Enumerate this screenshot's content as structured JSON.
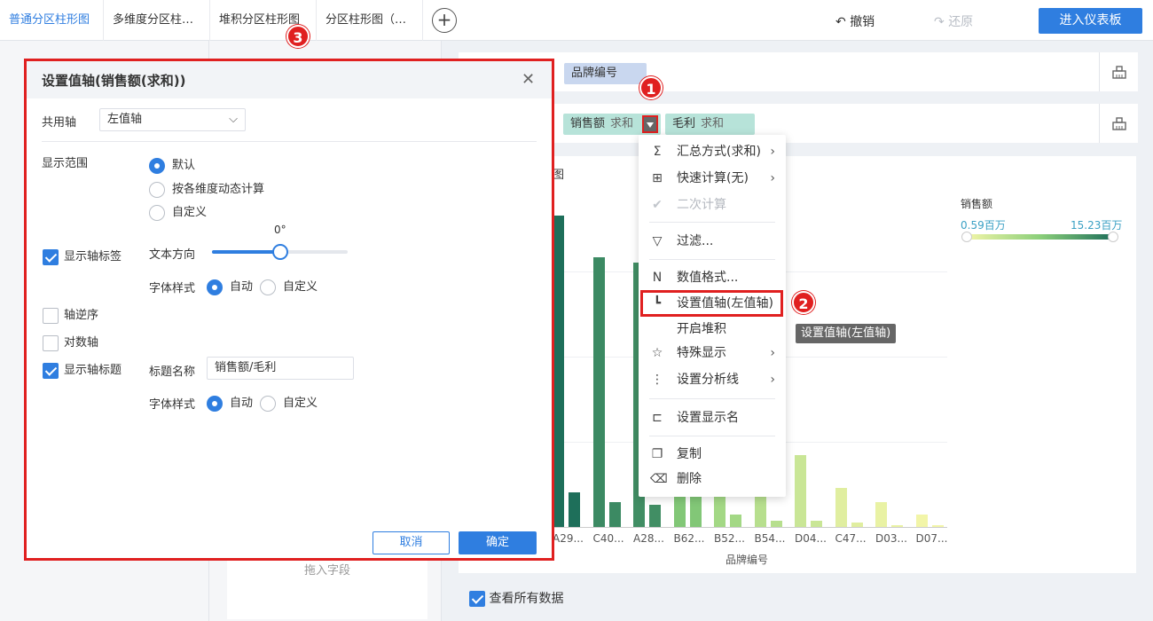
{
  "tabs": [
    {
      "label": "普通分区柱形图",
      "active": true
    },
    {
      "label": "多维度分区柱…"
    },
    {
      "label": "堆积分区柱形图"
    },
    {
      "label": "分区柱形图（…"
    }
  ],
  "toolbar": {
    "undo_label": "撤销",
    "redo_label": "还原",
    "enter_dashboard_label": "进入仪表板"
  },
  "fields": {
    "dimension_pill": "品牌编号",
    "sales_pill": {
      "name": "销售额",
      "agg": "求和"
    },
    "profit_pill": {
      "name": "毛利",
      "agg": "求和"
    }
  },
  "left_panel": {
    "drop_field_label": "拖入字段"
  },
  "chart": {
    "title_fragment": "图",
    "legend": {
      "title": "销售额",
      "min": "0.59百万",
      "max": "15.23百万"
    },
    "xlabel": "品牌编号"
  },
  "chart_data": {
    "type": "bar",
    "categories": [
      "A29...",
      "C40...",
      "A28...",
      "B62...",
      "B52...",
      "B54...",
      "D04...",
      "C47...",
      "D03...",
      "D07..."
    ],
    "series": [
      {
        "name": "销售额",
        "values": [
          15.23,
          13.2,
          12.9,
          8.5,
          6.2,
          4.8,
          3.5,
          1.9,
          1.2,
          0.59
        ]
      },
      {
        "name": "毛利",
        "values": [
          1.7,
          1.2,
          1.1,
          1.5,
          0.6,
          0.3,
          0.3,
          0.2,
          0.1,
          0.1
        ]
      }
    ],
    "xlabel": "品牌编号",
    "legend_position": "top-right"
  },
  "view_all": {
    "label": "查看所有数据",
    "checked": true
  },
  "menu": {
    "items": [
      {
        "label": "汇总方式(求和)",
        "icon": "sigma-icon",
        "glyph": "Σ",
        "submenu": true
      },
      {
        "label": "快速计算(无)",
        "icon": "quick-calc-icon",
        "glyph": "⊞",
        "submenu": true
      },
      {
        "label": "二次计算",
        "icon": "check-icon",
        "glyph": "✔",
        "disabled": true
      },
      {
        "label": "过滤...",
        "icon": "filter-icon",
        "glyph": "▽"
      },
      {
        "label": "数值格式...",
        "icon": "number-format-icon",
        "glyph": "N"
      },
      {
        "label": "设置值轴(左值轴)",
        "icon": "value-axis-icon",
        "glyph": "┗"
      },
      {
        "label": "开启堆积",
        "icon": "",
        "glyph": ""
      },
      {
        "label": "特殊显示",
        "icon": "star-icon",
        "glyph": "☆",
        "submenu": true
      },
      {
        "label": "设置分析线",
        "icon": "analysis-line-icon",
        "glyph": "⋮",
        "submenu": true
      },
      {
        "label": "设置显示名",
        "icon": "rename-icon",
        "glyph": "⊏"
      },
      {
        "label": "复制",
        "icon": "copy-icon",
        "glyph": "❐"
      },
      {
        "label": "删除",
        "icon": "trash-icon",
        "glyph": "🗑"
      }
    ],
    "tooltip": "设置值轴(左值轴)"
  },
  "steps": [
    "1",
    "2",
    "3"
  ],
  "dialog": {
    "title": "设置值轴(销售额(求和))",
    "shared_axis_label": "共用轴",
    "shared_axis_value": "左值轴",
    "range_label": "显示范围",
    "range_options": [
      "默认",
      "按各维度动态计算",
      "自定义"
    ],
    "range_selected": 0,
    "show_axis_labels": {
      "label": "显示轴标签",
      "checked": true
    },
    "text_direction_label": "文本方向",
    "text_direction_value": "0°",
    "text_direction_fraction": 0.5,
    "font_style_label": "字体样式",
    "font_style_options": [
      "自动",
      "自定义"
    ],
    "reverse_axis": {
      "label": "轴逆序",
      "checked": false
    },
    "log_axis": {
      "label": "对数轴",
      "checked": false
    },
    "show_axis_title": {
      "label": "显示轴标题",
      "checked": true
    },
    "title_name_label": "标题名称",
    "title_name_value": "销售额/毛利",
    "cancel_label": "取消",
    "ok_label": "确定"
  }
}
